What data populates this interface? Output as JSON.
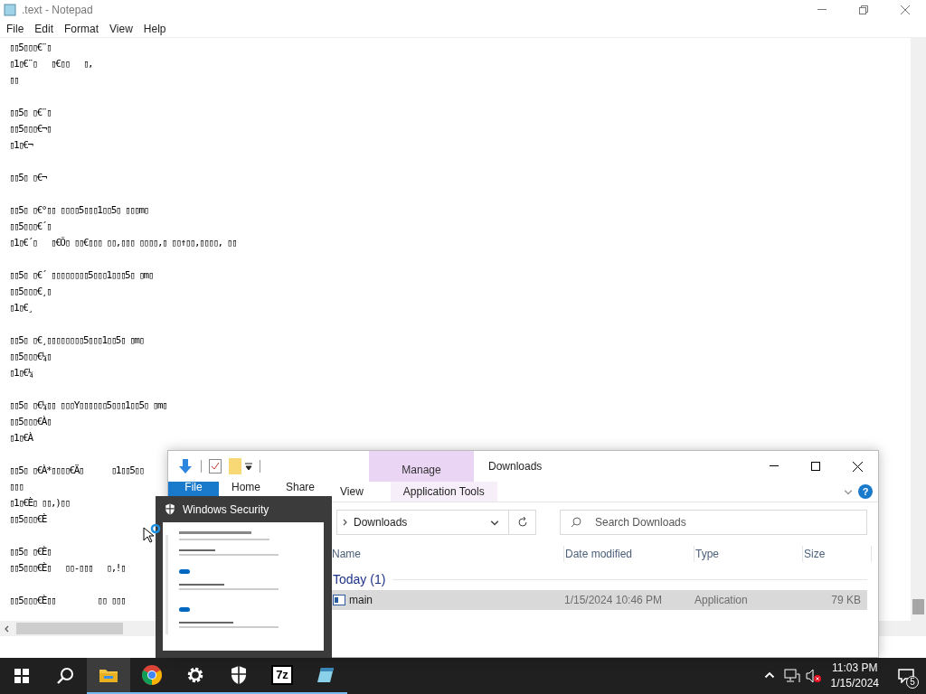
{
  "notepad": {
    "title": ".text - Notepad",
    "menu": [
      "File",
      "Edit",
      "Format",
      "View",
      "Help"
    ],
    "blocks": [
      [
        "▯▯5▯▯▯€¨▯",
        "▯1▯€¨▯   ▯€▯▯   ▯,",
        "▯▯"
      ],
      [
        "▯▯5▯ ▯€¨▯",
        "▯▯5▯▯▯€¬▯",
        "▯1▯€¬"
      ],
      [
        "▯▯5▯ ▯€¬"
      ],
      [
        "▯▯5▯ ▯€°▯▯ ▯▯▯▯5▯▯▯1▯▯5▯ ▯▯▯m▯",
        "▯▯5▯▯▯€´▯",
        "▯1▯€´▯   ▯€Õ▯ ▯▯€▯▯▯ ▯▯,▯▯▯ ▯▯▯▯,▯ ▯▯↑▯▯,▯▯▯▯, ▯▯"
      ],
      [
        "▯▯5▯ ▯€´ ▯▯▯▯▯▯▯▯5▯▯▯1▯▯▯5▯ ▯m▯",
        "▯▯5▯▯▯€¸▯",
        "▯1▯€¸"
      ],
      [
        "▯▯5▯ ▯€¸▯▯▯▯▯▯▯▯5▯▯▯1▯▯5▯ ▯m▯",
        "▯▯5▯▯▯€¼▯",
        "▯1▯€¼"
      ],
      [
        "▯▯5▯ ▯€¼▯▯ ▯▯▯Y▯▯▯▯▯▯5▯▯▯1▯▯5▯ ▯m▯",
        "▯▯5▯▯▯€À▯",
        "▯1▯€À"
      ],
      [
        "▯▯5▯ ▯€À*▯▯▯▯€Ä▯      ▯1▯▯5▯▯",
        "▯▯▯",
        "▯1▯€È▯ ▯▯,)▯▯",
        "▯▯5▯▯▯€È"
      ],
      [
        "▯▯5▯ ▯€È▯",
        "▯▯5▯▯▯€È▯   ▯▯-▯▯▯   ▯,!▯"
      ],
      [
        "▯▯5▯▯▯€È▯▯         ▯▯ ▯▯▯"
      ]
    ]
  },
  "explorer": {
    "title": "Downloads",
    "context_tab": "Manage",
    "help": "?",
    "tabs": [
      {
        "label": "File",
        "selected": true
      },
      {
        "label": "Home",
        "selected": false
      },
      {
        "label": "Share",
        "selected": false
      },
      {
        "label": "View",
        "selected": false
      },
      {
        "label": "Application Tools",
        "selected": false
      }
    ],
    "path": [
      "Downloads"
    ],
    "search": {
      "placeholder": "Search Downloads"
    },
    "columns": [
      "Name",
      "Date modified",
      "Type",
      "Size"
    ],
    "group": "Today (1)",
    "rows": [
      {
        "name": "main",
        "date": "1/15/2024 10:46 PM",
        "type": "Application",
        "size": "79 KB",
        "selected": true
      }
    ]
  },
  "preview": {
    "title": "Windows Security"
  },
  "taskbar": {
    "apps": [
      {
        "kind": "explorer",
        "active": true
      },
      {
        "kind": "chrome",
        "active": false
      },
      {
        "kind": "settings",
        "active": false
      },
      {
        "kind": "security",
        "active": false
      },
      {
        "kind": "archive",
        "label": "7z",
        "active": false
      },
      {
        "kind": "notepad",
        "active": false
      }
    ],
    "time": "11:03 PM",
    "date": "1/15/2024",
    "notifications": "5"
  }
}
